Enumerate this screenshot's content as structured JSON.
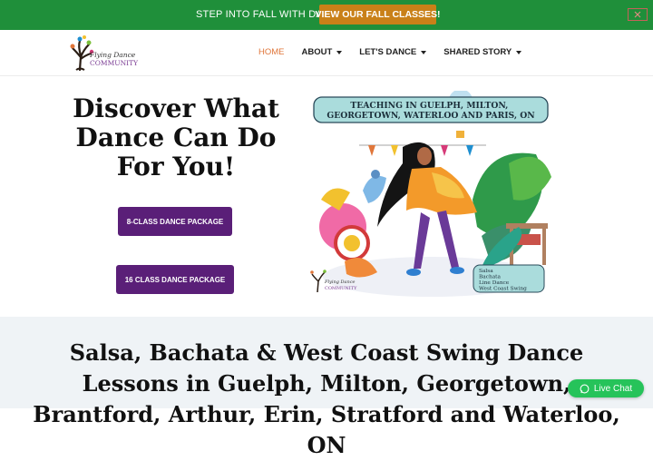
{
  "topbar": {
    "text": "STEP INTO FALL WITH DANCE",
    "button_label": "VIEW OUR FALL CLASSES!",
    "close_icon": "close-icon"
  },
  "header": {
    "logo": {
      "line1": "Flying Dance",
      "line2": "COMMUNITY"
    },
    "nav": [
      {
        "label": "HOME",
        "active": true,
        "dropdown": false
      },
      {
        "label": "ABOUT",
        "active": false,
        "dropdown": true
      },
      {
        "label": "LET'S DANCE",
        "active": false,
        "dropdown": true
      },
      {
        "label": "SHARED STORY",
        "active": false,
        "dropdown": true
      }
    ]
  },
  "hero": {
    "title": "Discover What Dance Can Do For You!",
    "buttons": [
      {
        "label": "8-CLASS DANCE PACKAGE"
      },
      {
        "label": "16 CLASS DANCE PACKAGE"
      }
    ],
    "illustration": {
      "banner": "TEACHING IN GUELPH, MILTON, GEORGETOWN, WATERLOO AND PARIS, ON",
      "styles": [
        "Salsa",
        "Bachata",
        "Line Dance",
        "West Coast Swing"
      ],
      "logo": {
        "line1": "Flying Dance",
        "line2": "COMMUNITY"
      }
    }
  },
  "section": {
    "title": "Salsa, Bachata & West Coast Swing Dance Lessons in Guelph, Milton, Georgetown, Brantford, Arthur, Erin, Stratford and Waterloo, ON"
  },
  "livechat": {
    "label": "Live Chat"
  },
  "colors": {
    "topbar": "#1f8f3a",
    "topbar_button": "#c98018",
    "nav_active": "#e0763a",
    "package_button": "#5a1f78",
    "band": "#eff3f6",
    "livechat": "#26c35a"
  }
}
